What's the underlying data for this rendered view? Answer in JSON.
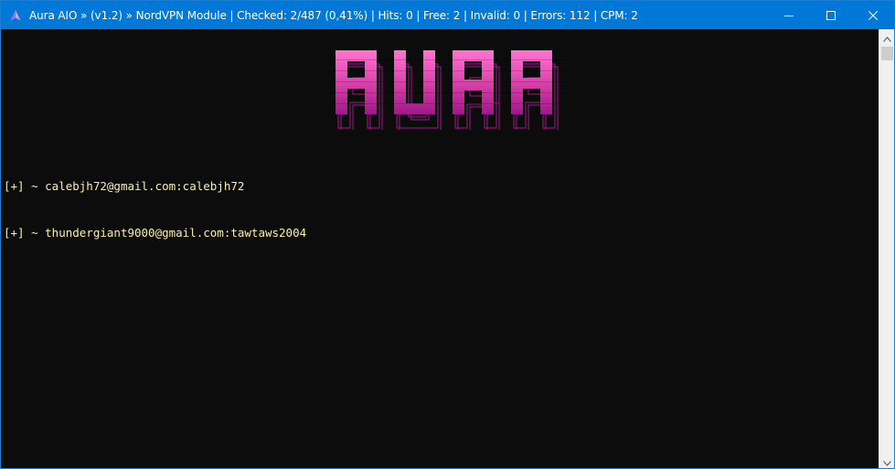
{
  "window": {
    "title": "Aura AIO » (v1.2) » NordVPN Module | Checked: 2/487 (0,41%) | Hits: 0 | Free: 2 | Invalid: 0 | Errors: 112 | CPM: 2",
    "app_icon": "aura-logo-icon",
    "controls": [
      "minimize-icon",
      "maximize-icon",
      "close-icon"
    ]
  },
  "terminal": {
    "banner_text": "AURA",
    "banner_colors": [
      "#ff66cc",
      "#e84fb4",
      "#cc3399",
      "#a61f86"
    ],
    "text_color": "#f9f1a5",
    "lines": [
      {
        "prefix": "[+] ~ ",
        "text": "calebjh72@gmail.com:calebjh72"
      },
      {
        "prefix": "[+] ~ ",
        "text": "thundergiant9000@gmail.com:tawtaws2004"
      }
    ]
  },
  "scrollbar": {
    "up_arrow": "scroll-up-icon",
    "down_arrow": "scroll-down-icon"
  }
}
